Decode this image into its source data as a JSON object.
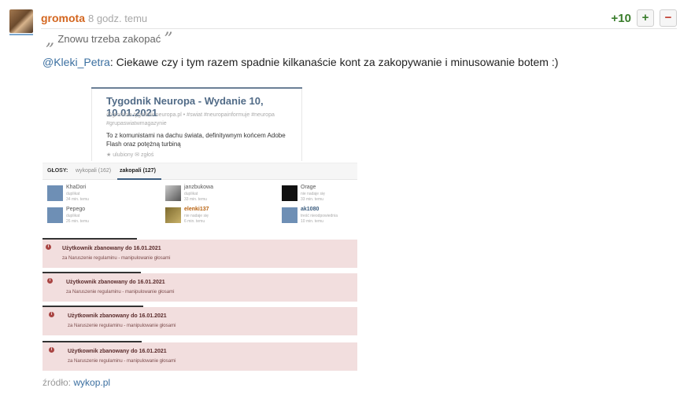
{
  "entry": {
    "author": "gromota",
    "time": "8 godz. temu",
    "score": "+10",
    "vote_plus_label": "+",
    "vote_minus_label": "−",
    "quote_open": "„",
    "quote_text": "Znowu trzeba zakopać",
    "quote_close": "”",
    "comment_prefix": "@",
    "mention": "Kleki_Petra",
    "comment_text": ": Ciekawe czy i tym razem spadnie kilkanaście kont za zakopywanie i minusowanie botem :)"
  },
  "embed": {
    "card": {
      "title": "Tygodnik Neuropa - Wydanie 10, 10.01.2021",
      "meta": "@gromota  tygodnik.neuropa.pl  •  #swiat  #neuropainformuje  #neuropa  #grupaswiatwmagazynie",
      "description": "To z komunistami na dachu świata, definitywnym końcem Adobe Flash oraz potężną turbiną",
      "footer": "★ ulubiony   ✉ zgłoś"
    },
    "tabs": {
      "label": "GŁOSY:",
      "dug": "wykopali (162)",
      "buried": "zakopali (127)"
    },
    "voters": [
      {
        "name": "KhaDori",
        "reason": "duplikat",
        "time": "34 min. temu",
        "avatar": "blue"
      },
      {
        "name": "janzbukowa",
        "reason": "duplikat",
        "time": "33 min. temu",
        "avatar": "photo"
      },
      {
        "name": "Orage",
        "reason": "nie nadaje się",
        "time": "33 min. temu",
        "avatar": "dark"
      },
      {
        "name": "Pepego",
        "reason": "duplikat",
        "time": "26 min. temu",
        "avatar": "blue"
      },
      {
        "name": "elenki137",
        "reason": "nie nadaje się",
        "time": "6 min. temu",
        "avatar": "gold"
      },
      {
        "name": "ak1080",
        "reason": "treść nieodpowiednia",
        "time": "10 min. temu",
        "avatar": "blue"
      }
    ],
    "bans": [
      {
        "title": "Użytkownik zbanowany do 16.01.2021",
        "detail": "za Naruszenie regulaminu - manipulowanie głosami"
      },
      {
        "title": "Użytkownik zbanowany do 16.01.2021",
        "detail": "za Naruszenie regulaminu - manipulowanie głosami"
      },
      {
        "title": "Użytkownik zbanowany do 16.01.2021",
        "detail": "za Naruszenie regulaminu - manipulowanie głosami"
      },
      {
        "title": "Użytkownik zbanowany do 16.01.2021",
        "detail": "za Naruszenie regulaminu - manipulowanie głosami"
      }
    ]
  },
  "source": {
    "label": "źródło:",
    "link": "wykop.pl"
  },
  "colors": {
    "author": "#d3661f",
    "score": "#3a7d2c",
    "link": "#3b6fa0",
    "ban_bg": "#f2dede"
  }
}
